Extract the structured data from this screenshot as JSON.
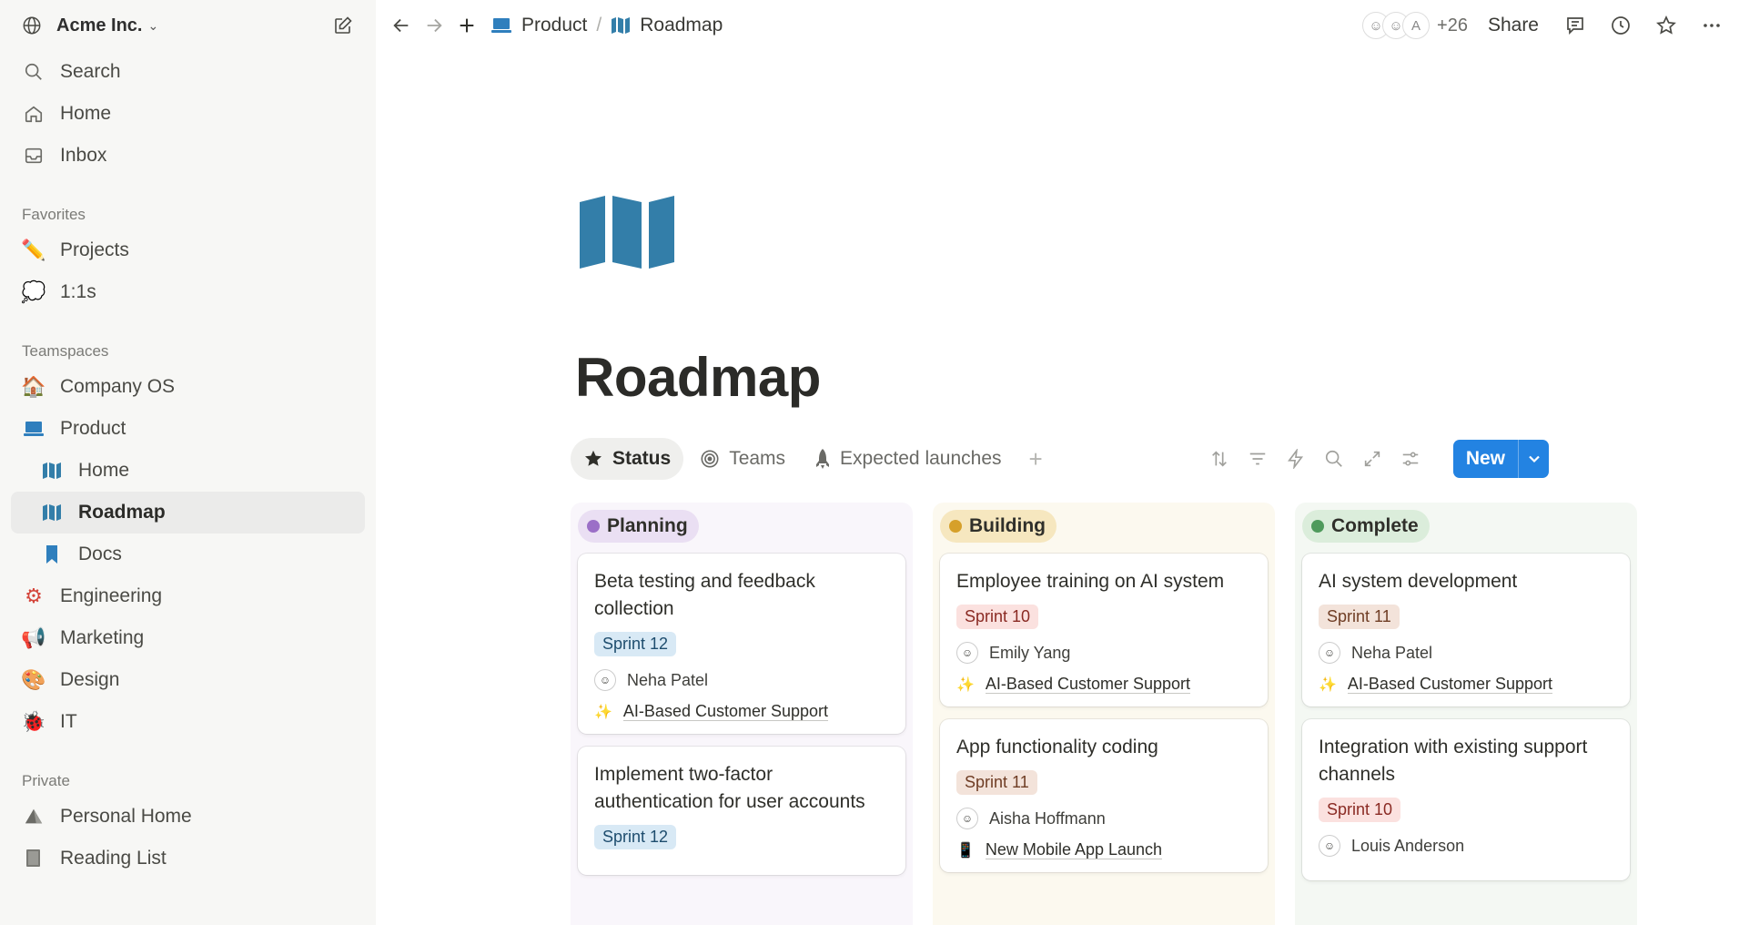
{
  "workspace": {
    "name": "Acme Inc."
  },
  "sidebar": {
    "top": [
      {
        "label": "Search",
        "icon": "search-icon"
      },
      {
        "label": "Home",
        "icon": "home-icon"
      },
      {
        "label": "Inbox",
        "icon": "inbox-icon"
      }
    ],
    "favorites_title": "Favorites",
    "favorites": [
      {
        "label": "Projects",
        "icon": "pencil-icon"
      },
      {
        "label": "1:1s",
        "icon": "speech-bubble-icon"
      }
    ],
    "teamspaces_title": "Teamspaces",
    "teamspaces": [
      {
        "label": "Company OS",
        "icon": "house-icon"
      },
      {
        "label": "Product",
        "icon": "laptop-icon"
      },
      {
        "label": "Home",
        "icon": "map-icon"
      },
      {
        "label": "Roadmap",
        "icon": "map-icon"
      },
      {
        "label": "Docs",
        "icon": "bookmark-icon"
      },
      {
        "label": "Engineering",
        "icon": "gear-icon"
      },
      {
        "label": "Marketing",
        "icon": "megaphone-icon"
      },
      {
        "label": "Design",
        "icon": "palette-icon"
      },
      {
        "label": "IT",
        "icon": "bug-icon"
      }
    ],
    "private_title": "Private",
    "private": [
      {
        "label": "Personal Home",
        "icon": "pyramid-icon"
      },
      {
        "label": "Reading List",
        "icon": "book-icon"
      }
    ]
  },
  "topbar": {
    "breadcrumb": [
      "Product",
      "Roadmap"
    ],
    "avatar_letter": "A",
    "avatar_count": "+26",
    "share_label": "Share"
  },
  "page": {
    "title": "Roadmap",
    "views": [
      "Status",
      "Teams",
      "Expected launches"
    ],
    "new_label": "New"
  },
  "board": {
    "columns": [
      {
        "name": "Planning",
        "cards": [
          {
            "title": "Beta testing and feedback collection",
            "sprint": "Sprint 12",
            "assignee": "Neha Patel",
            "project": "AI-Based Customer Support"
          },
          {
            "title": "Implement two-factor authentication for user accounts",
            "sprint": "Sprint 12"
          }
        ]
      },
      {
        "name": "Building",
        "cards": [
          {
            "title": "Employee training on AI system",
            "sprint": "Sprint 10",
            "assignee": "Emily Yang",
            "project": "AI-Based Customer Support"
          },
          {
            "title": "App functionality coding",
            "sprint": "Sprint 11",
            "assignee": "Aisha Hoffmann",
            "project": "New Mobile App Launch"
          }
        ]
      },
      {
        "name": "Complete",
        "cards": [
          {
            "title": "AI system development",
            "sprint": "Sprint 11",
            "assignee": "Neha Patel",
            "project": "AI-Based Customer Support"
          },
          {
            "title": "Integration with existing support channels",
            "sprint": "Sprint 10",
            "assignee": "Louis Anderson"
          }
        ]
      }
    ]
  },
  "colors": {
    "accent": "#2383e2",
    "sidebar_bg": "#f7f7f5",
    "map_icon": "#337ea9"
  }
}
